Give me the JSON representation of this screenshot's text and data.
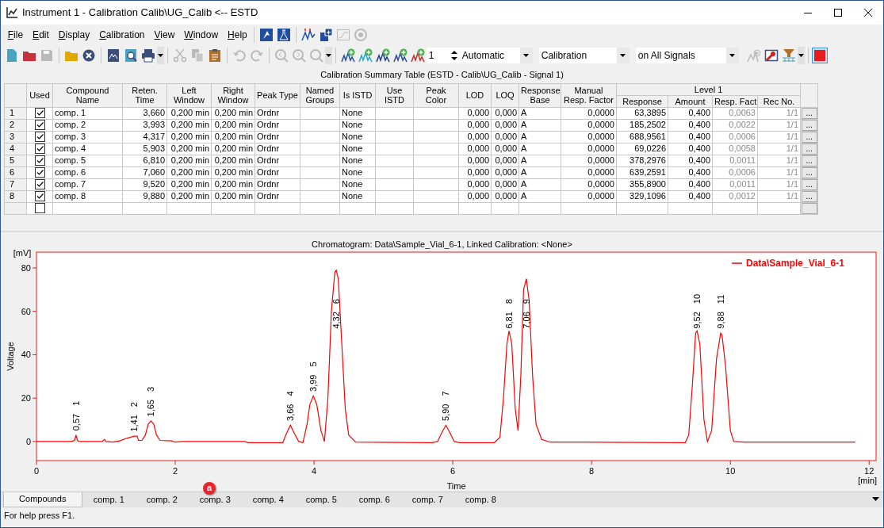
{
  "window": {
    "title": "Instrument 1 - Calibration Calib\\UG_Calib <-- ESTD"
  },
  "menu": [
    {
      "label": "File"
    },
    {
      "label": "Edit"
    },
    {
      "label": "Display"
    },
    {
      "label": "Calibration"
    },
    {
      "label": "View"
    },
    {
      "label": "Window"
    },
    {
      "label": "Help"
    }
  ],
  "menu_toolbar": [
    {
      "kind": "logo",
      "disabled": false
    },
    {
      "kind": "flask",
      "disabled": false
    },
    {
      "kind": "separator"
    },
    {
      "kind": "peaks",
      "disabled": false
    },
    {
      "kind": "calc",
      "disabled": false
    },
    {
      "kind": "graph",
      "disabled": true
    },
    {
      "kind": "target",
      "disabled": true
    }
  ],
  "toolbar": [
    {
      "kind": "new",
      "disabled": false
    },
    {
      "kind": "case",
      "disabled": false
    },
    {
      "kind": "save",
      "disabled": true
    },
    {
      "kind": "separator"
    },
    {
      "kind": "open",
      "disabled": false
    },
    {
      "kind": "close",
      "disabled": false
    },
    {
      "kind": "separator"
    },
    {
      "kind": "report",
      "disabled": false
    },
    {
      "kind": "preview",
      "disabled": false
    },
    {
      "kind": "print",
      "disabled": false
    },
    {
      "kind": "dropdown"
    },
    {
      "kind": "separator"
    },
    {
      "kind": "cut",
      "disabled": true
    },
    {
      "kind": "copy",
      "disabled": true
    },
    {
      "kind": "paste",
      "disabled": false
    },
    {
      "kind": "separator"
    },
    {
      "kind": "undo",
      "disabled": true
    },
    {
      "kind": "redo",
      "disabled": true
    },
    {
      "kind": "separator"
    },
    {
      "kind": "zoomin",
      "disabled": true
    },
    {
      "kind": "zoomout",
      "disabled": true
    },
    {
      "kind": "zoom",
      "disabled": true
    },
    {
      "kind": "dropdown"
    },
    {
      "kind": "separator"
    },
    {
      "kind": "addpeak",
      "disabled": false,
      "color": "#1f4e9e"
    },
    {
      "kind": "addpeak",
      "disabled": false,
      "color": "#1fa8d8"
    },
    {
      "kind": "addpeak",
      "disabled": false,
      "color": "#1a3a8a"
    },
    {
      "kind": "addpeak",
      "disabled": false,
      "color": "#2a4aa0"
    },
    {
      "kind": "addpeak",
      "disabled": false,
      "color": "#c03030"
    },
    {
      "kind": "spin",
      "value": "1"
    },
    {
      "kind": "combo",
      "value": "Automatic"
    },
    {
      "kind": "combo",
      "value": "Calibration"
    },
    {
      "kind": "combo",
      "value": "on All Signals"
    },
    {
      "kind": "removepeak",
      "disabled": true
    },
    {
      "kind": "wrench",
      "disabled": false
    },
    {
      "kind": "filter",
      "disabled": false
    },
    {
      "kind": "dropdown"
    },
    {
      "kind": "separator"
    },
    {
      "kind": "stop",
      "selected": true
    }
  ],
  "table": {
    "title": "Calibration Summary Table (ESTD - Calib\\UG_Calib - Signal 1)",
    "columns": [
      {
        "label": "Used",
        "kind": "check"
      },
      {
        "label": "Compound Name",
        "kind": "text"
      },
      {
        "label": "Reten. Time",
        "kind": "number"
      },
      {
        "label": "Left Window",
        "kind": "number"
      },
      {
        "label": "Right Window",
        "kind": "number"
      },
      {
        "label": "Peak Type",
        "kind": "text"
      },
      {
        "label": "Named Groups",
        "kind": "text"
      },
      {
        "label": "Is ISTD",
        "kind": "text"
      },
      {
        "label": "Use ISTD",
        "kind": "text"
      },
      {
        "label": "Peak Color",
        "kind": "text"
      },
      {
        "label": "LOD",
        "kind": "number"
      },
      {
        "label": "LOQ",
        "kind": "number"
      },
      {
        "label": "Response Base",
        "kind": "text"
      },
      {
        "label": "Manual Resp. Factor",
        "kind": "number"
      }
    ],
    "level": {
      "label": "Level 1",
      "columns": [
        {
          "label": "Response",
          "readonly": false
        },
        {
          "label": "Amount",
          "readonly": false
        },
        {
          "label": "Resp. Fact",
          "readonly": true
        },
        {
          "label": "Rec No.",
          "readonly": true
        }
      ]
    },
    "rows": [
      {
        "number": "1",
        "used": true,
        "cells": [
          "comp. 1",
          "3,660",
          "0,200 min",
          "0,200 min",
          "Ordnr",
          null,
          "None",
          null,
          null,
          "0,000",
          "0,000",
          "A",
          "0,0000"
        ],
        "level": [
          "63,3895",
          "0,400",
          "0,0063",
          "1/1"
        ],
        "button": "..."
      },
      {
        "number": "2",
        "used": true,
        "cells": [
          "comp. 2",
          "3,993",
          "0,200 min",
          "0,200 min",
          "Ordnr",
          null,
          "None",
          null,
          null,
          "0,000",
          "0,000",
          "A",
          "0,0000"
        ],
        "level": [
          "185,2502",
          "0,400",
          "0,0022",
          "1/1"
        ],
        "button": "..."
      },
      {
        "number": "3",
        "used": true,
        "cells": [
          "comp. 3",
          "4,317",
          "0,200 min",
          "0,200 min",
          "Ordnr",
          null,
          "None",
          null,
          null,
          "0,000",
          "0,000",
          "A",
          "0,0000"
        ],
        "level": [
          "688,9561",
          "0,400",
          "0,0006",
          "1/1"
        ],
        "button": "..."
      },
      {
        "number": "4",
        "used": true,
        "cells": [
          "comp. 4",
          "5,903",
          "0,200 min",
          "0,200 min",
          "Ordnr",
          null,
          "None",
          null,
          null,
          "0,000",
          "0,000",
          "A",
          "0,0000"
        ],
        "level": [
          "69,0226",
          "0,400",
          "0,0058",
          "1/1"
        ],
        "button": "..."
      },
      {
        "number": "5",
        "used": true,
        "cells": [
          "comp. 5",
          "6,810",
          "0,200 min",
          "0,200 min",
          "Ordnr",
          null,
          "None",
          null,
          null,
          "0,000",
          "0,000",
          "A",
          "0,0000"
        ],
        "level": [
          "378,2976",
          "0,400",
          "0,0011",
          "1/1"
        ],
        "button": "..."
      },
      {
        "number": "6",
        "used": true,
        "cells": [
          "comp. 6",
          "7,060",
          "0,200 min",
          "0,200 min",
          "Ordnr",
          null,
          "None",
          null,
          null,
          "0,000",
          "0,000",
          "A",
          "0,0000"
        ],
        "level": [
          "639,2591",
          "0,400",
          "0,0006",
          "1/1"
        ],
        "button": "..."
      },
      {
        "number": "7",
        "used": true,
        "cells": [
          "comp. 7",
          "9,520",
          "0,200 min",
          "0,200 min",
          "Ordnr",
          null,
          "None",
          null,
          null,
          "0,000",
          "0,000",
          "A",
          "0,0000"
        ],
        "level": [
          "355,8900",
          "0,400",
          "0,0011",
          "1/1"
        ],
        "button": "..."
      },
      {
        "number": "8",
        "used": true,
        "cells": [
          "comp. 8",
          "9,880",
          "0,200 min",
          "0,200 min",
          "Ordnr",
          null,
          "None",
          null,
          null,
          "0,000",
          "0,000",
          "A",
          "0,0000"
        ],
        "level": [
          "329,1096",
          "0,400",
          "0,0012",
          "1/1"
        ],
        "button": "..."
      },
      {
        "used": false
      }
    ]
  },
  "chromatogram": {
    "title": "Chromatogram: Data\\Sample_Vial_6-1, Linked Calibration: <None>",
    "y_unit": "[mV]",
    "x_unit": "[min]",
    "chart_data": {
      "type": "line",
      "xlabel": "Time",
      "ylabel": "Voltage",
      "xlim": [
        0,
        12.1
      ],
      "ylim": [
        -8.8,
        87.3
      ],
      "xticks": [
        0,
        2,
        4,
        6,
        8,
        10,
        12
      ],
      "yticks": [
        0,
        20,
        40,
        60,
        80
      ],
      "x": [
        0,
        0.5,
        0.55,
        0.57,
        0.59,
        0.62,
        0.95,
        0.98,
        1.0,
        1.1,
        1.2,
        1.3,
        1.41,
        1.45,
        1.47,
        1.52,
        1.57,
        1.61,
        1.65,
        1.69,
        1.73,
        1.78,
        1.95,
        2.0,
        2.1,
        3.0,
        3.05,
        3.55,
        3.6,
        3.66,
        3.72,
        3.78,
        3.84,
        3.9,
        3.94,
        3.99,
        4.04,
        4.1,
        4.15,
        4.2,
        4.25,
        4.3,
        4.32,
        4.35,
        4.4,
        4.45,
        4.5,
        4.6,
        5.7,
        5.78,
        5.84,
        5.9,
        5.96,
        6.02,
        6.1,
        6.6,
        6.68,
        6.73,
        6.78,
        6.81,
        6.85,
        6.9,
        6.94,
        6.98,
        7.02,
        7.06,
        7.1,
        7.15,
        7.2,
        7.28,
        7.4,
        7.9,
        9.35,
        9.4,
        9.45,
        9.5,
        9.52,
        9.56,
        9.62,
        9.67,
        9.73,
        9.8,
        9.86,
        9.88,
        9.93,
        10.0,
        10.05,
        10.2,
        11.8
      ],
      "series": [
        {
          "name": "Data\\Sample_Vial_6-1",
          "color": "#ff0000",
          "values": [
            0,
            0,
            0.5,
            3,
            0.5,
            0,
            0,
            1,
            0,
            -0.3,
            0.3,
            1.5,
            2.5,
            2.5,
            0.5,
            0.5,
            3,
            8,
            9.5,
            8,
            3,
            0.5,
            0.3,
            -0.3,
            0,
            0,
            -0.5,
            -0.5,
            3.5,
            7.5,
            3.5,
            0,
            -0.5,
            8,
            17,
            21,
            17,
            5,
            0,
            20,
            60,
            78,
            79,
            75,
            45,
            15,
            3,
            -0.3,
            -0.5,
            0,
            4,
            7.5,
            4,
            0,
            -0.5,
            -0.5,
            2,
            20,
            45,
            51,
            45,
            15,
            5,
            30,
            70,
            75,
            65,
            30,
            8,
            1,
            -0.3,
            -0.3,
            -0.5,
            3,
            25,
            50,
            51,
            45,
            10,
            0,
            5,
            38,
            50,
            49,
            35,
            5,
            0,
            -0.3,
            -0.3
          ]
        }
      ],
      "annotations": [
        "0,57 1",
        "1,41 2",
        "1,65 3",
        "3,66 4",
        "3,99 5",
        "4,32 6",
        "5,90 7",
        "6,81 8",
        "7,06 9",
        "9,52 10",
        "9,88 11"
      ]
    }
  },
  "tabs": [
    {
      "label": "Compounds",
      "selected": true
    },
    {
      "label": "comp. 1",
      "selected": false
    },
    {
      "label": "comp. 2",
      "selected": false
    },
    {
      "label": "comp. 3",
      "selected": false
    },
    {
      "label": "comp. 4",
      "selected": false
    },
    {
      "label": "comp. 5",
      "selected": false
    },
    {
      "label": "comp. 6",
      "selected": false
    },
    {
      "label": "comp. 7",
      "selected": false
    },
    {
      "label": "comp. 8",
      "selected": false
    }
  ],
  "callout": {
    "label": "a"
  },
  "status_bar": "For help press F1."
}
